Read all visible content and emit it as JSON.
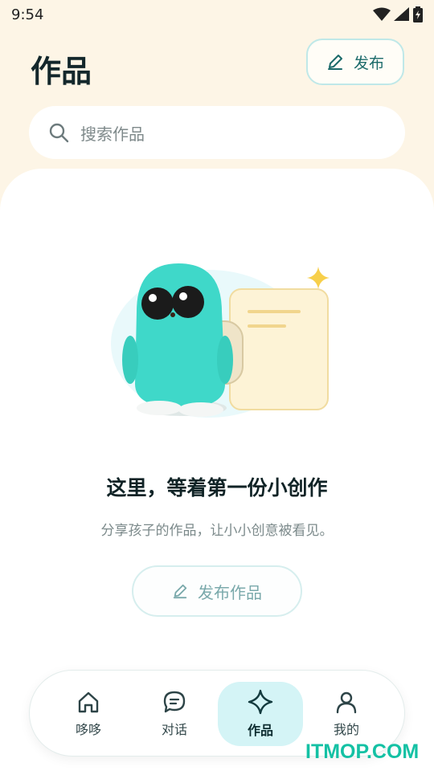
{
  "status_bar": {
    "time": "9:54",
    "icons": [
      "wifi-icon",
      "signal-icon",
      "battery-icon"
    ]
  },
  "header": {
    "title": "作品",
    "publish_label": "发布"
  },
  "search": {
    "placeholder": "搜索作品"
  },
  "empty_state": {
    "title": "这里，等着第一份小创作",
    "description": "分享孩子的作品，让小小创意被看见。",
    "button_label": "发布作品"
  },
  "tabs": [
    {
      "label": "哆哆",
      "icon": "home-icon",
      "active": false
    },
    {
      "label": "对话",
      "icon": "chat-icon",
      "active": false
    },
    {
      "label": "作品",
      "icon": "sparkle-icon",
      "active": true
    },
    {
      "label": "我的",
      "icon": "profile-icon",
      "active": false
    }
  ],
  "watermark": "ITMOP.COM",
  "colors": {
    "accent": "#1b6a6a",
    "active_tab_bg": "#d4f4f6",
    "background": "#fdf5e6",
    "mascot": "#3fd8c9"
  }
}
